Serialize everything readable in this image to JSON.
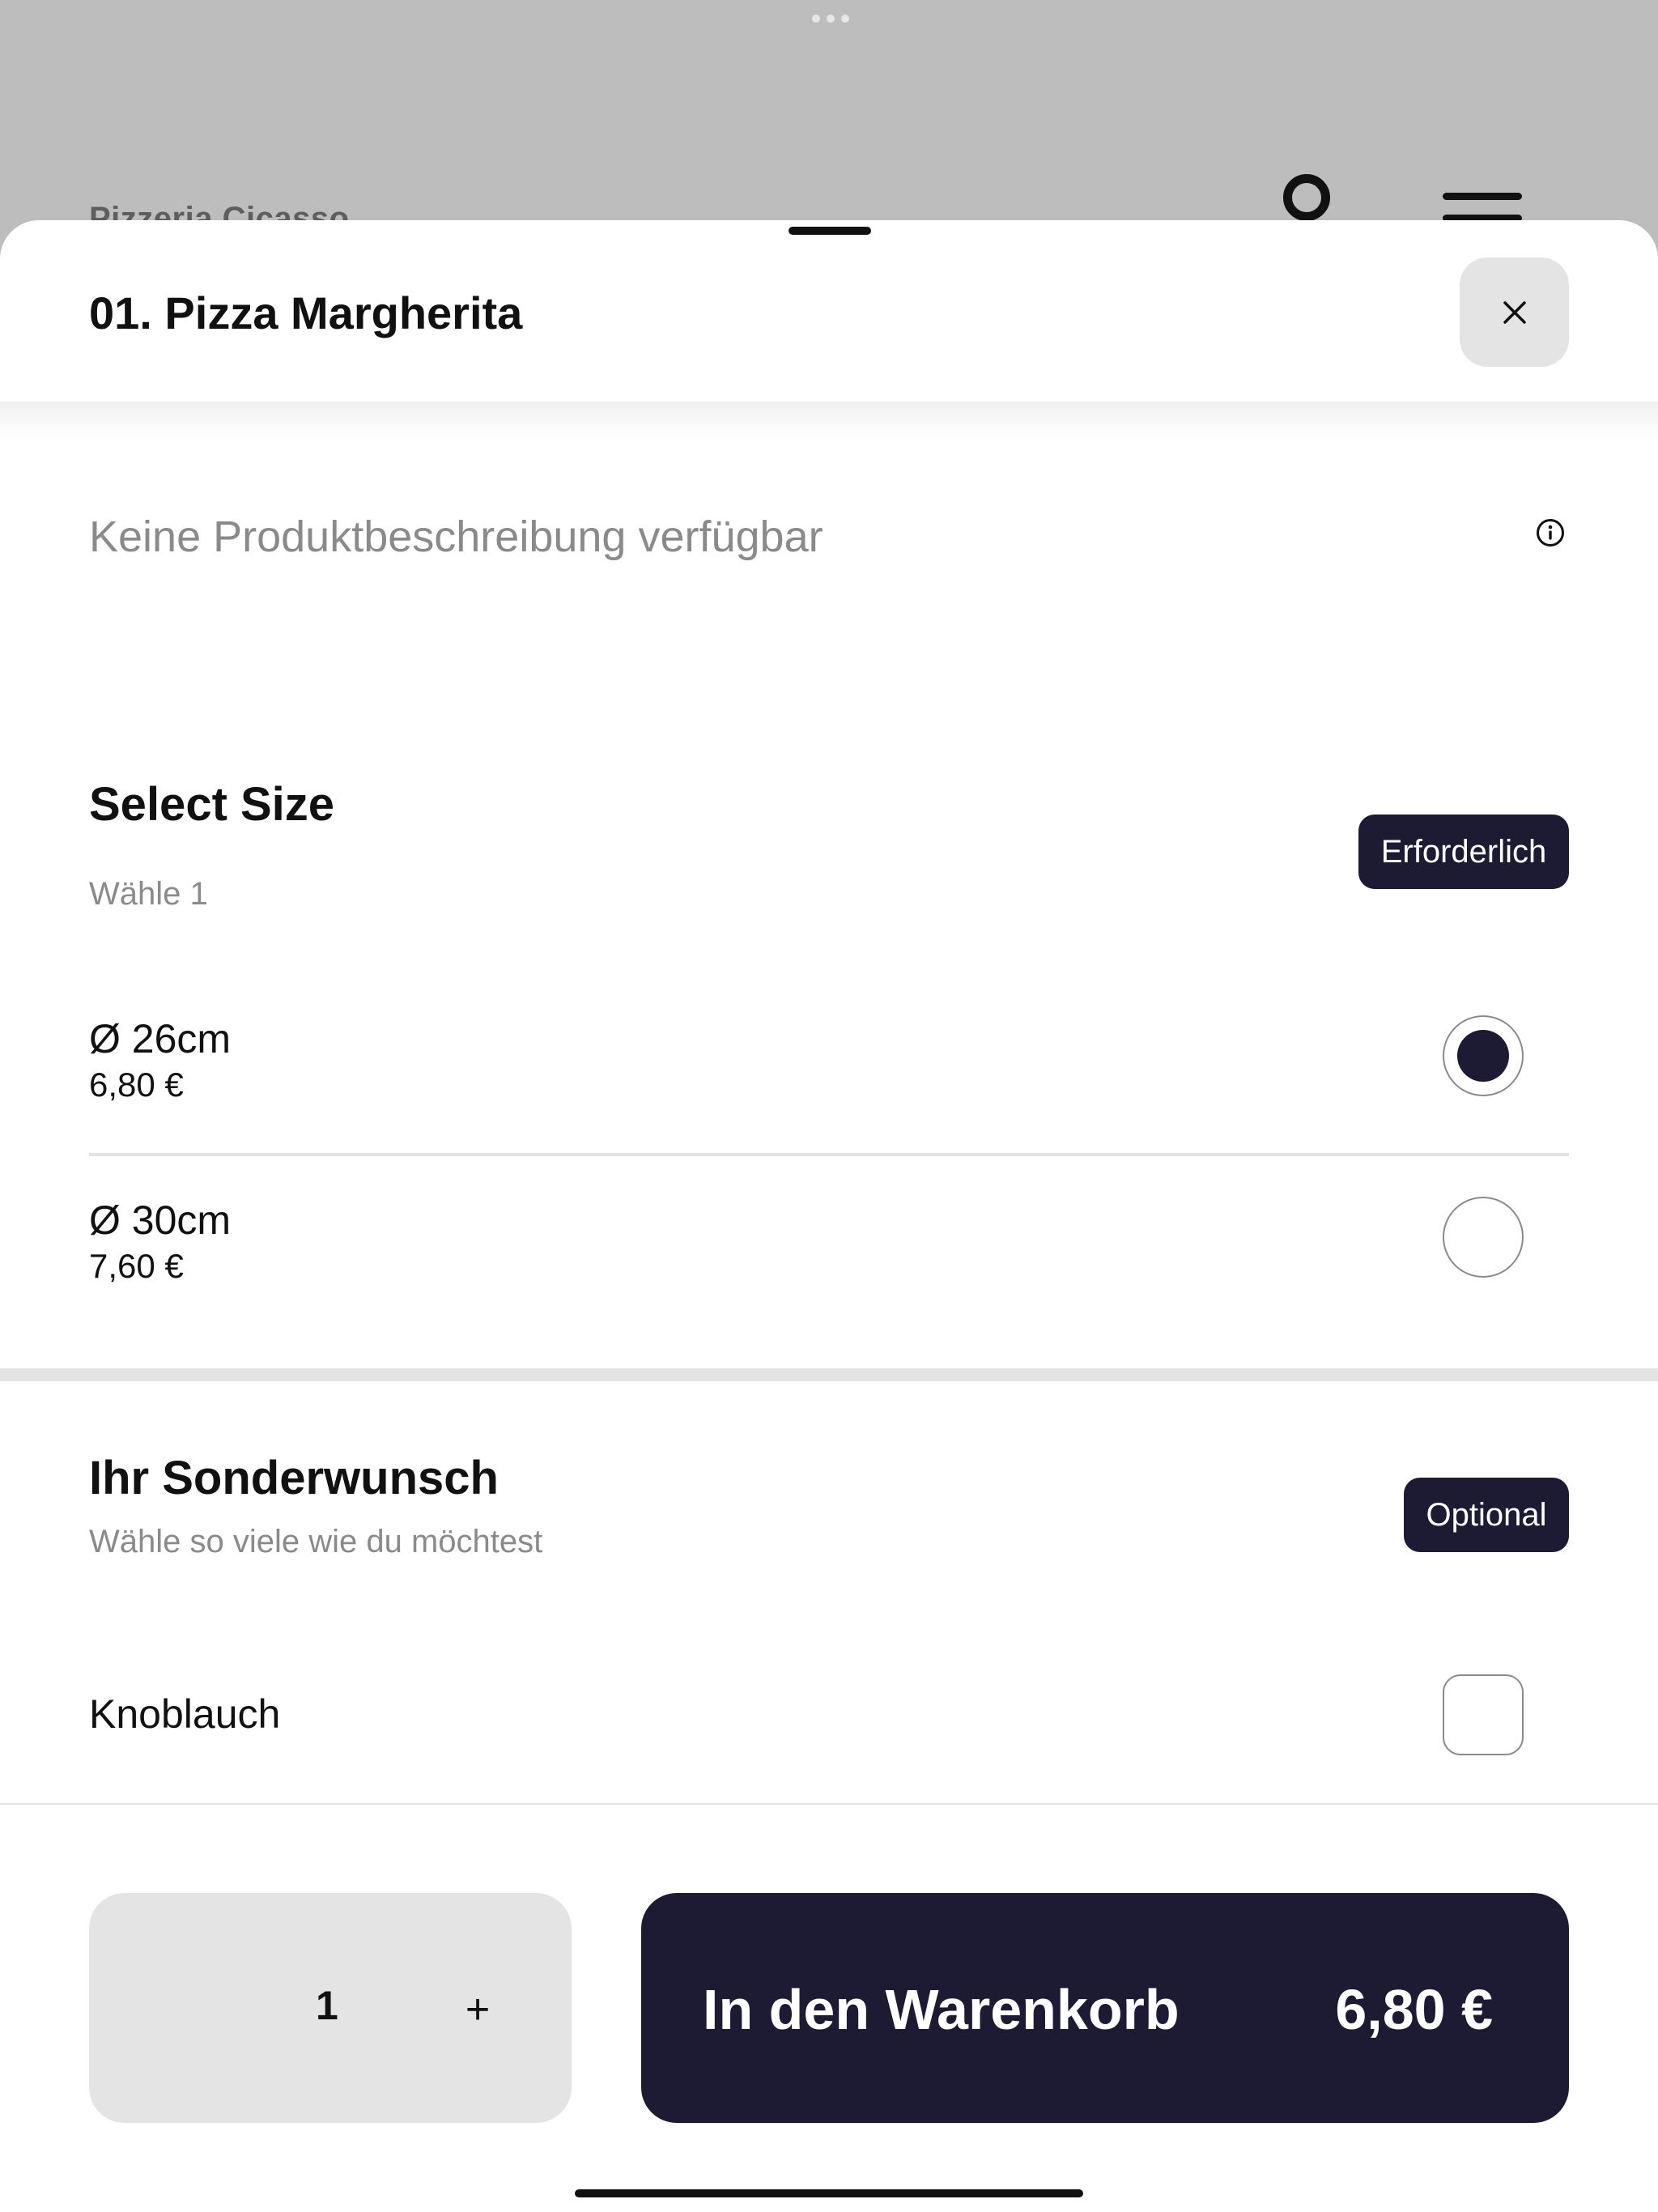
{
  "background": {
    "restaurant_name": "Pizzeria Cicasso"
  },
  "product": {
    "title": "01. Pizza Margherita",
    "description": "Keine Produktbeschreibung verfügbar"
  },
  "size_section": {
    "title": "Select Size",
    "subtitle": "Wähle 1",
    "badge": "Erforderlich",
    "options": [
      {
        "label": "Ø 26cm",
        "price": "6,80 €",
        "selected": true
      },
      {
        "label": "Ø 30cm",
        "price": "7,60 €",
        "selected": false
      }
    ]
  },
  "extras_section": {
    "title": "Ihr Sonderwunsch",
    "subtitle": "Wähle so viele wie du möchtest",
    "badge": "Optional",
    "options": [
      {
        "label": "Knoblauch",
        "checked": false
      }
    ]
  },
  "footer": {
    "quantity": "1",
    "plus_label": "+",
    "cart_label": "In den Warenkorb",
    "cart_price": "6,80 €"
  },
  "icons": {
    "close": "close-icon",
    "info": "info-icon",
    "account": "account-icon",
    "menu": "menu-icon"
  },
  "colors": {
    "accent": "#1d1b33",
    "muted_text": "#8a8a8a",
    "surface_gray": "#e4e4e4"
  }
}
